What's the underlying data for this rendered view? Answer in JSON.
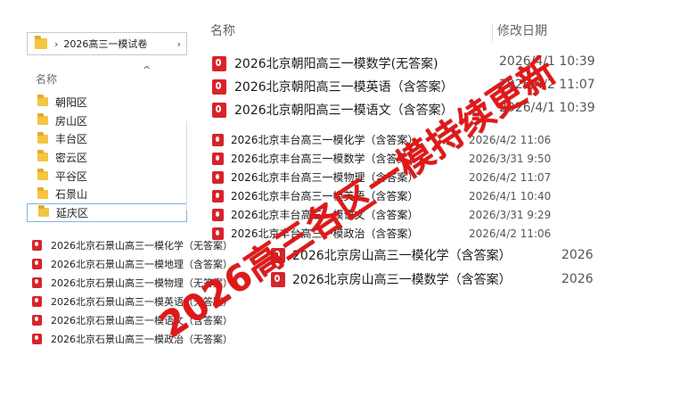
{
  "breadcrumb": {
    "folder": "2026高三一模试卷"
  },
  "nav": {
    "header": "名称",
    "items": [
      "朝阳区",
      "房山区",
      "丰台区",
      "密云区",
      "平谷区",
      "石景山",
      "延庆区"
    ],
    "selected": "延庆区"
  },
  "left_files": [
    "2026北京石景山高三一模化学（无答案）",
    "2026北京石景山高三一模地理（含答案）",
    "2026北京石景山高三一模物理（无答案）",
    "2026北京石景山高三一模英语（无答案）",
    "2026北京石景山高三一模语文（含答案）",
    "2026北京石景山高三一模政治（无答案）"
  ],
  "columns": {
    "name": "名称",
    "date": "修改日期"
  },
  "top_files": [
    {
      "name": "2026北京朝阳高三一模数学(无答案)",
      "date": "2026/4/1 10:39"
    },
    {
      "name": "2026北京朝阳高三一模英语（含答案）",
      "date": "2026/4/2 11:07"
    },
    {
      "name": "2026北京朝阳高三一模语文（含答案）",
      "date": "2026/4/1 10:39"
    }
  ],
  "mid_files": [
    {
      "name": "2026北京丰台高三一模化学（含答案）",
      "date": "2026/4/2 11:06"
    },
    {
      "name": "2026北京丰台高三一模数学（含答案）",
      "date": "2026/3/31 9:50"
    },
    {
      "name": "2026北京丰台高三一模物理（含答案）",
      "date": "2026/4/2 11:07"
    },
    {
      "name": "2026北京丰台高三一模英语（含答案）",
      "date": "2026/4/1 10:40"
    },
    {
      "name": "2026北京丰台高三一模语文（含答案）",
      "date": "2026/3/31 9:29"
    },
    {
      "name": "2026北京丰台高三一模政治（含答案）",
      "date": "2026/4/2 11:06"
    }
  ],
  "bottom_files": [
    {
      "name": "2026北京房山高三一模化学（含答案）",
      "date": "2026"
    },
    {
      "name": "2026北京房山高三一模数学（含答案）",
      "date": "2026"
    }
  ],
  "overlay": "2026高三各区一模持续更新"
}
